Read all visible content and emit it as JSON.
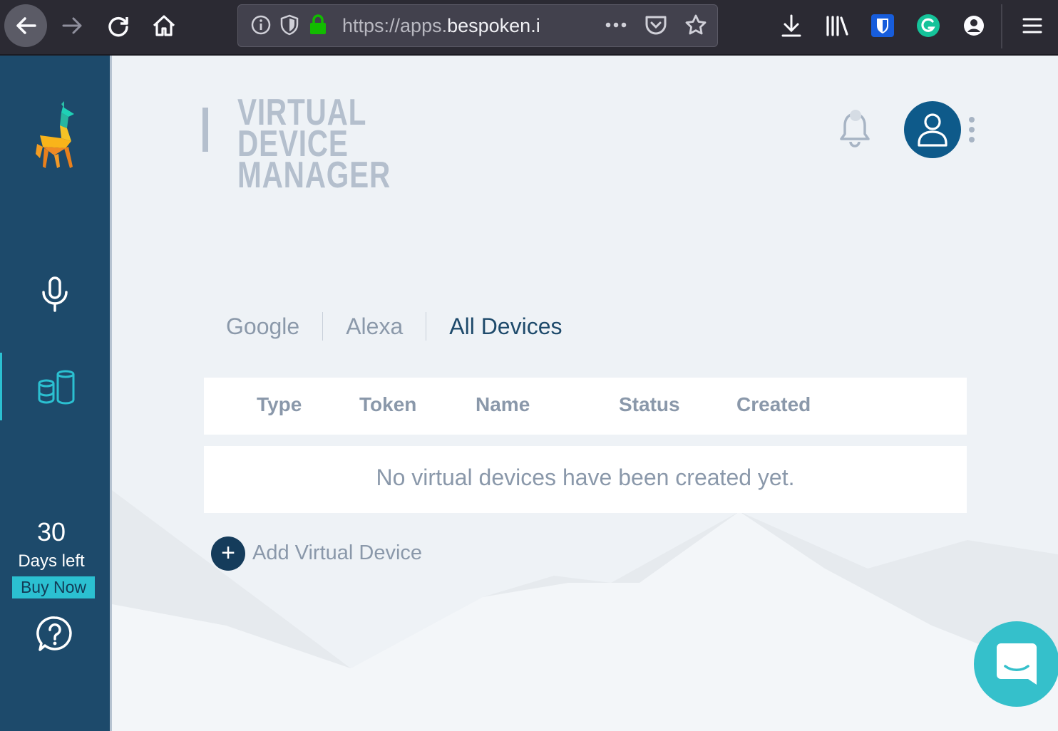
{
  "browser": {
    "url_prefix": "https://apps.",
    "url_domain": "bespoken.i"
  },
  "sidebar": {
    "days_count": "30",
    "days_label": "Days left",
    "buy_now_label": "Buy Now"
  },
  "header": {
    "title_line1": "VIRTUAL DEVICE",
    "title_line2": "MANAGER"
  },
  "tabs": [
    {
      "label": "Google"
    },
    {
      "label": "Alexa"
    },
    {
      "label": "All Devices"
    }
  ],
  "table": {
    "columns": [
      "Type",
      "Token",
      "Name",
      "Status",
      "Created"
    ],
    "empty_message": "No virtual devices have been created yet."
  },
  "add_device_label": "Add Virtual Device",
  "colors": {
    "sidebar": "#1d4a6b",
    "accent": "#2bc0d1",
    "active_tab": "#1e4a6b",
    "chat": "#35c0cb"
  }
}
